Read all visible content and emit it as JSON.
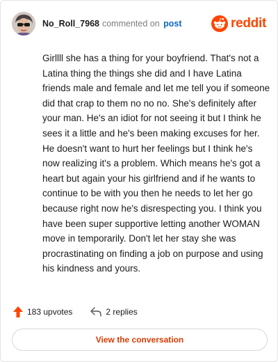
{
  "header": {
    "username": "No_Roll_7968",
    "action_text": "commented on",
    "object_text": "post",
    "brand_name": "reddit"
  },
  "comment": {
    "body": "Girllll she has a thing for your boyfriend. That's not a Latina thing the things she did and I have Latina friends male and female and let me tell you if someone did that crap to them no no no. She's definitely after your man. He's an idiot for not seeing it but I think he sees it a little and he's been making excuses for her. He doesn't want to hurt her feelings but I think he's now realizing it's a problem. Which means he's got a heart but again your his girlfriend and if he wants to continue to be with you then he needs to let her go because right now he's disrespecting you. I think you have been super supportive letting another WOMAN move in temporarily. Don't let her stay she was procrastinating on finding a job on purpose and using his kindness and yours."
  },
  "stats": {
    "upvotes_label": "183 upvotes",
    "replies_label": "2 replies"
  },
  "cta": {
    "label": "View the conversation"
  },
  "icons": {
    "upvote": "upvote-arrow-icon",
    "reply": "reply-arrow-icon",
    "brand": "reddit-snoo-icon"
  },
  "colors": {
    "brand": "#ff4500",
    "upvote": "#ff4500",
    "link": "#0a66c2",
    "cta_text": "#d93a00"
  }
}
